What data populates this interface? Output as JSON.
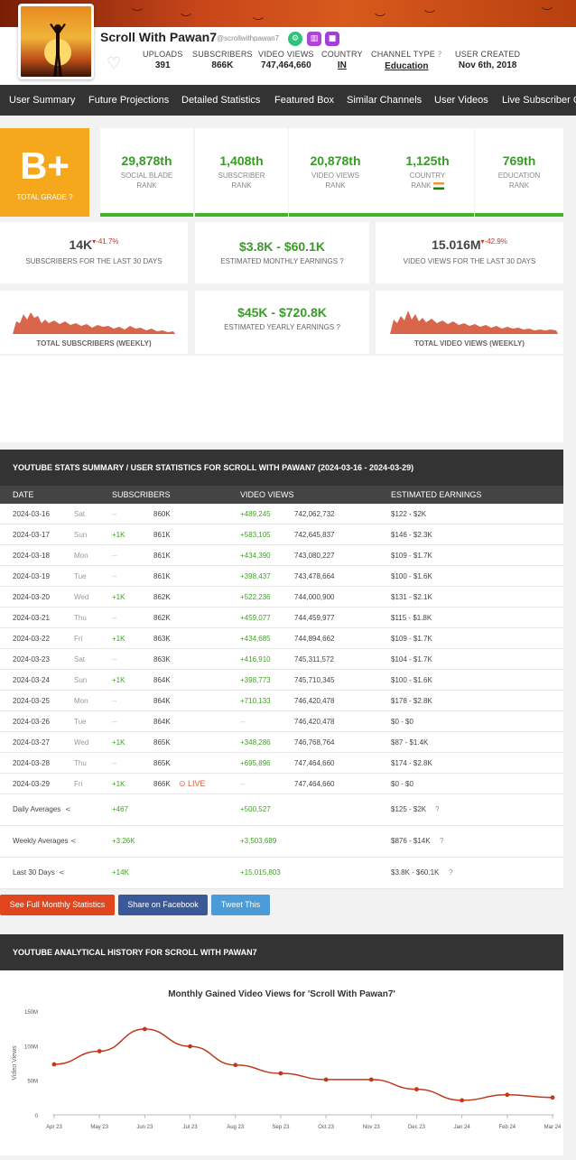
{
  "header": {
    "channel_name": "Scroll With Pawan7",
    "handle": "@scrollwithpawan7",
    "stats": [
      {
        "label": "UPLOADS",
        "value": "391"
      },
      {
        "label": "SUBSCRIBERS",
        "value": "866K"
      },
      {
        "label": "VIDEO VIEWS",
        "value": "747,464,660"
      },
      {
        "label": "COUNTRY",
        "value": "IN"
      },
      {
        "label": "CHANNEL TYPE",
        "value": "Education"
      },
      {
        "label": "USER CREATED",
        "value": "Nov 6th, 2018"
      }
    ],
    "badge_colors": [
      "#2ec27e",
      "#b044d8",
      "#a23fd9"
    ]
  },
  "nav": [
    "User Summary",
    "Future Projections",
    "Detailed Statistics",
    "Featured Box",
    "Similar Channels",
    "User Videos",
    "Live Subscriber Co"
  ],
  "grade": {
    "value": "B+",
    "label": "TOTAL GRADE"
  },
  "ranks": [
    {
      "value": "29,878th",
      "label1": "SOCIAL BLADE",
      "label2": "RANK"
    },
    {
      "value": "1,408th",
      "label1": "SUBSCRIBER",
      "label2": "RANK"
    },
    {
      "value": "20,878th",
      "label1": "VIDEO VIEWS",
      "label2": "RANK"
    },
    {
      "value": "1,125th",
      "label1": "COUNTRY",
      "label2": "RANK"
    },
    {
      "value": "769th",
      "label1": "EDUCATION",
      "label2": "RANK"
    }
  ],
  "summary": {
    "subs30": {
      "value": "14K",
      "delta": "-41.7%",
      "label": "SUBSCRIBERS FOR THE LAST 30 DAYS"
    },
    "monthly": {
      "value": "$3.8K  -  $60.1K",
      "label": "ESTIMATED MONTHLY EARNINGS"
    },
    "views30": {
      "value": "15.016M",
      "delta": "-42.9%",
      "label": "VIDEO VIEWS FOR THE LAST 30 DAYS"
    },
    "yearly": {
      "value": "$45K  -  $720.8K",
      "label": "ESTIMATED YEARLY EARNINGS"
    },
    "spark_subs_label": "TOTAL SUBSCRIBERS (WEEKLY)",
    "spark_views_label": "TOTAL VIDEO VIEWS (WEEKLY)"
  },
  "stats_table": {
    "title": "YOUTUBE STATS SUMMARY / USER STATISTICS FOR SCROLL WITH PAWAN7 (2024-03-16 - 2024-03-29)",
    "headers": [
      "DATE",
      "SUBSCRIBERS",
      "VIDEO VIEWS",
      "ESTIMATED EARNINGS"
    ],
    "rows": [
      {
        "date": "2024-03-16",
        "dow": "Sat",
        "subd": "--",
        "sub": "860K",
        "vvd": "+489,245",
        "vv": "742,062,732",
        "earn": "$122  -  $2K"
      },
      {
        "date": "2024-03-17",
        "dow": "Sun",
        "subd": "+1K",
        "sub": "861K",
        "vvd": "+583,105",
        "vv": "742,645,837",
        "earn": "$146  -  $2.3K"
      },
      {
        "date": "2024-03-18",
        "dow": "Mon",
        "subd": "--",
        "sub": "861K",
        "vvd": "+434,390",
        "vv": "743,080,227",
        "earn": "$109  -  $1.7K"
      },
      {
        "date": "2024-03-19",
        "dow": "Tue",
        "subd": "--",
        "sub": "861K",
        "vvd": "+398,437",
        "vv": "743,478,664",
        "earn": "$100  -  $1.6K"
      },
      {
        "date": "2024-03-20",
        "dow": "Wed",
        "subd": "+1K",
        "sub": "862K",
        "vvd": "+522,236",
        "vv": "744,000,900",
        "earn": "$131  -  $2.1K"
      },
      {
        "date": "2024-03-21",
        "dow": "Thu",
        "subd": "--",
        "sub": "862K",
        "vvd": "+459,077",
        "vv": "744,459,977",
        "earn": "$115  -  $1.8K"
      },
      {
        "date": "2024-03-22",
        "dow": "Fri",
        "subd": "+1K",
        "sub": "863K",
        "vvd": "+434,685",
        "vv": "744,894,662",
        "earn": "$109  -  $1.7K"
      },
      {
        "date": "2024-03-23",
        "dow": "Sat",
        "subd": "--",
        "sub": "863K",
        "vvd": "+416,910",
        "vv": "745,311,572",
        "earn": "$104  -  $1.7K"
      },
      {
        "date": "2024-03-24",
        "dow": "Sun",
        "subd": "+1K",
        "sub": "864K",
        "vvd": "+398,773",
        "vv": "745,710,345",
        "earn": "$100  -  $1.6K"
      },
      {
        "date": "2024-03-25",
        "dow": "Mon",
        "subd": "--",
        "sub": "864K",
        "vvd": "+710,133",
        "vv": "746,420,478",
        "earn": "$178  -  $2.8K"
      },
      {
        "date": "2024-03-26",
        "dow": "Tue",
        "subd": "--",
        "sub": "864K",
        "vvd": "--",
        "vv": "746,420,478",
        "earn": "$0  -  $0"
      },
      {
        "date": "2024-03-27",
        "dow": "Wed",
        "subd": "+1K",
        "sub": "865K",
        "vvd": "+348,286",
        "vv": "746,768,764",
        "earn": "$87  -  $1.4K"
      },
      {
        "date": "2024-03-28",
        "dow": "Thu",
        "subd": "--",
        "sub": "865K",
        "vvd": "+695,896",
        "vv": "747,464,660",
        "earn": "$174  -  $2.8K"
      },
      {
        "date": "2024-03-29",
        "dow": "Fri",
        "subd": "+1K",
        "sub": "866K",
        "vvd": "--",
        "vv": "747,464,660",
        "earn": "$0  -  $0",
        "live": "LIVE"
      }
    ],
    "averages": [
      {
        "label": "Daily Averages",
        "subs": "+467",
        "views": "+500,527",
        "earn": "$125  -  $2K"
      },
      {
        "label": "Weekly Averages",
        "subs": "+3.26K",
        "views": "+3,503,689",
        "earn": "$876  -  $14K"
      },
      {
        "label": "Last 30 Days",
        "subs": "+14K",
        "views": "+15,015,803",
        "earn": "$3.8K  -  $60.1K"
      }
    ]
  },
  "buttons": {
    "monthly": "See Full Monthly Statistics",
    "facebook": "Share on Facebook",
    "tweet": "Tweet This"
  },
  "history": {
    "title": "YOUTUBE ANALYTICAL HISTORY FOR SCROLL WITH PAWAN7"
  },
  "chart_data": {
    "type": "line",
    "title": "Monthly Gained Video Views for 'Scroll With Pawan7'",
    "ylabel": "Video Views",
    "xlabel": "",
    "categories": [
      "Apr 23",
      "May 23",
      "Jun 23",
      "Jul 23",
      "Aug 23",
      "Sep 23",
      "Oct 23",
      "Nov 23",
      "Dec 23",
      "Jan 24",
      "Feb 24",
      "Mar 24"
    ],
    "values": [
      73000000,
      92000000,
      124000000,
      99000000,
      72000000,
      60000000,
      51000000,
      51000000,
      37000000,
      21000000,
      29000000,
      25000000
    ],
    "yticks": [
      "0",
      "50M",
      "100M",
      "150M"
    ],
    "ylim": [
      0,
      150000000
    ],
    "color": "#c0391b",
    "grid": false
  }
}
